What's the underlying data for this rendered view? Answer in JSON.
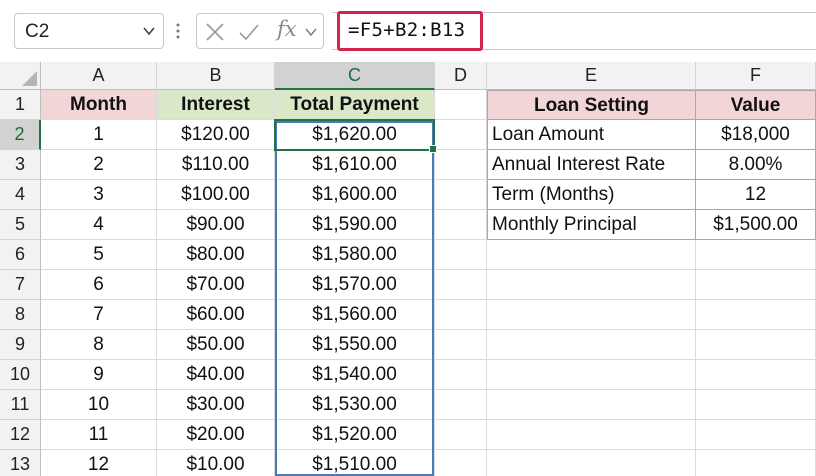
{
  "name_box": {
    "value": "C2"
  },
  "formula_bar": {
    "cancel_icon": "cancel-icon",
    "enter_icon": "enter-icon",
    "fx_label": "fx",
    "formula": "=F5+B2:B13"
  },
  "columns": [
    "A",
    "B",
    "C",
    "D",
    "E",
    "F"
  ],
  "rows": [
    "1",
    "2",
    "3",
    "4",
    "5",
    "6",
    "7",
    "8",
    "9",
    "10",
    "11",
    "12",
    "13"
  ],
  "active_cell": "C2",
  "headers": {
    "month": "Month",
    "interest": "Interest",
    "total_payment": "Total Payment"
  },
  "table": [
    {
      "month": "1",
      "interest": "$120.00",
      "total": "$1,620.00"
    },
    {
      "month": "2",
      "interest": "$110.00",
      "total": "$1,610.00"
    },
    {
      "month": "3",
      "interest": "$100.00",
      "total": "$1,600.00"
    },
    {
      "month": "4",
      "interest": "$90.00",
      "total": "$1,590.00"
    },
    {
      "month": "5",
      "interest": "$80.00",
      "total": "$1,580.00"
    },
    {
      "month": "6",
      "interest": "$70.00",
      "total": "$1,570.00"
    },
    {
      "month": "7",
      "interest": "$60.00",
      "total": "$1,560.00"
    },
    {
      "month": "8",
      "interest": "$50.00",
      "total": "$1,550.00"
    },
    {
      "month": "9",
      "interest": "$40.00",
      "total": "$1,540.00"
    },
    {
      "month": "10",
      "interest": "$30.00",
      "total": "$1,530.00"
    },
    {
      "month": "11",
      "interest": "$20.00",
      "total": "$1,520.00"
    },
    {
      "month": "12",
      "interest": "$10.00",
      "total": "$1,510.00"
    }
  ],
  "loan": {
    "header_setting": "Loan Setting",
    "header_value": "Value",
    "rows": [
      {
        "setting": "Loan Amount",
        "value": "$18,000"
      },
      {
        "setting": "Annual Interest Rate",
        "value": "8.00%"
      },
      {
        "setting": "Term (Months)",
        "value": "12"
      },
      {
        "setting": "Monthly Principal",
        "value": "$1,500.00"
      }
    ]
  },
  "colors": {
    "header_red": "#f2d6d7",
    "header_green": "#d9e8c7",
    "formula_highlight": "#d3234f",
    "active_green": "#217346",
    "range_blue": "#4a7ab8"
  }
}
